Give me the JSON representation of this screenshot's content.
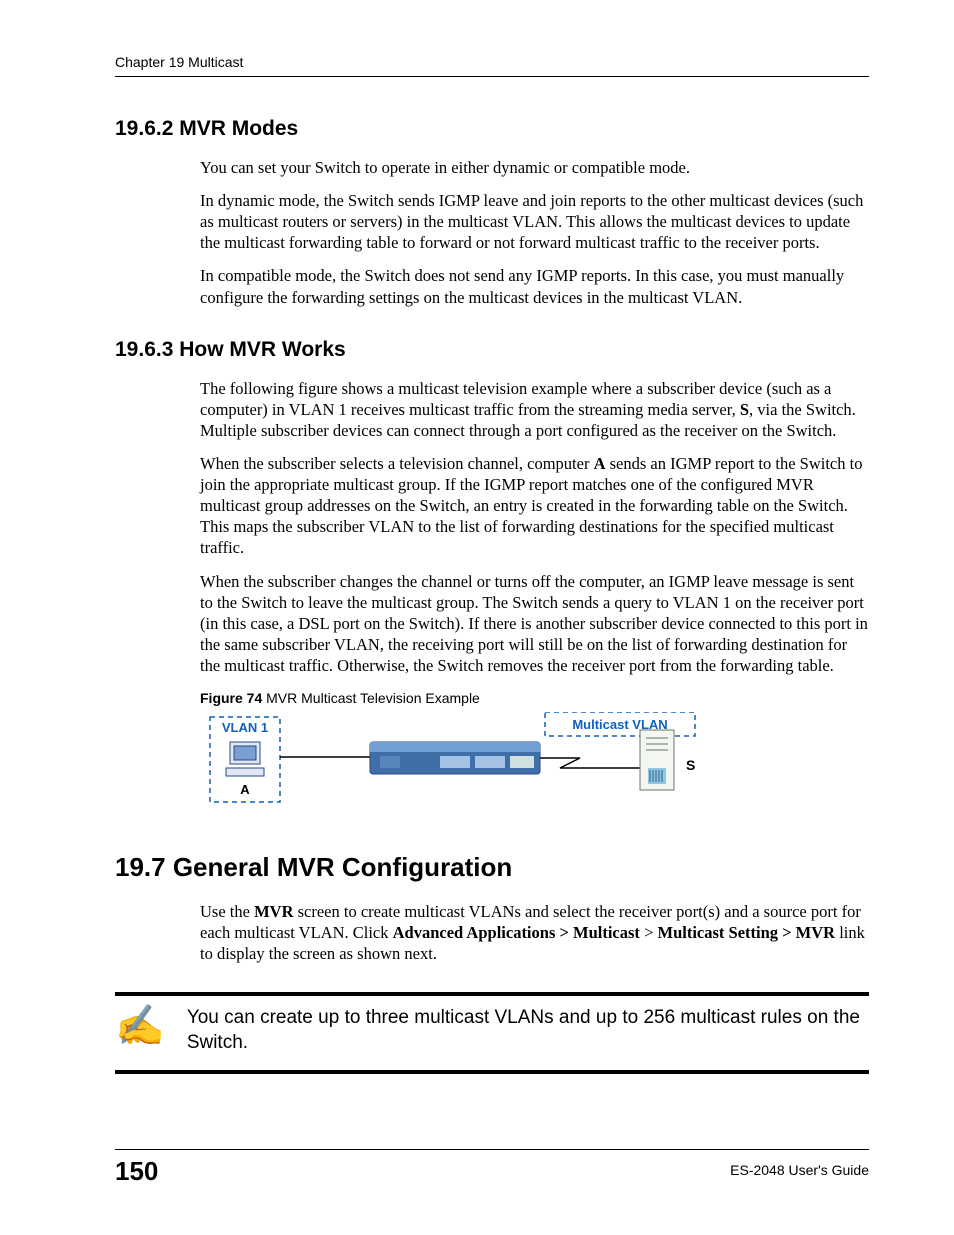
{
  "header": {
    "chapter": "Chapter 19 Multicast"
  },
  "sections": {
    "s1": {
      "heading": "19.6.2  MVR Modes",
      "p1": "You can set your Switch to operate in either dynamic or compatible mode.",
      "p2": "In dynamic mode, the Switch sends IGMP leave and join reports to the other multicast devices (such as multicast routers or servers) in the multicast VLAN. This allows the multicast devices to update the multicast forwarding table to forward or not forward multicast traffic to the receiver ports.",
      "p3": "In compatible mode, the Switch does not send any IGMP reports. In this case, you must manually configure the forwarding settings on the multicast devices in the multicast VLAN."
    },
    "s2": {
      "heading": "19.6.3  How MVR Works",
      "p1_a": "The following figure shows a multicast television example where a subscriber device (such as a computer) in VLAN 1 receives multicast traffic from the streaming media server, ",
      "p1_b": "S",
      "p1_c": ", via the Switch. Multiple subscriber devices can connect through a port configured as the receiver on the Switch.",
      "p2_a": "When the subscriber selects a television channel, computer ",
      "p2_b": "A",
      "p2_c": " sends an IGMP report to the Switch to join the appropriate multicast group. If the IGMP report matches one of the configured MVR multicast group addresses on the Switch, an entry is created in the forwarding table on the Switch. This maps the subscriber VLAN to the list of forwarding destinations for the specified multicast traffic.",
      "p3": "When the subscriber changes the channel or turns off the computer, an IGMP leave message is sent to the Switch to leave the multicast group. The Switch sends a query to VLAN 1 on the receiver port (in this case, a DSL port on the Switch). If there is another subscriber device connected to this port in the same subscriber VLAN, the receiving port will still be on the list of forwarding destination for the multicast traffic. Otherwise, the Switch removes the receiver port from the forwarding table."
    },
    "figure": {
      "label_num": "Figure 74",
      "label_text": "   MVR Multicast Television Example",
      "vlan1": "VLAN 1",
      "a": "A",
      "mvlan": "Multicast VLAN",
      "s": "S"
    },
    "s3": {
      "heading": "19.7  General MVR Configuration",
      "p1_a": "Use the ",
      "p1_b": "MVR",
      "p1_c": " screen to create multicast VLANs and select the receiver port(s) and a source port for each multicast VLAN. Click ",
      "p1_d": "Advanced Applications > Multicast",
      "p1_e": " > ",
      "p1_f": "Multicast Setting > MVR",
      "p1_g": " link to display the screen as shown next."
    },
    "note": {
      "icon": "✍",
      "text": "You can create up to three multicast VLANs and up to 256 multicast rules on the Switch."
    }
  },
  "footer": {
    "page": "150",
    "guide": "ES-2048 User's Guide"
  }
}
